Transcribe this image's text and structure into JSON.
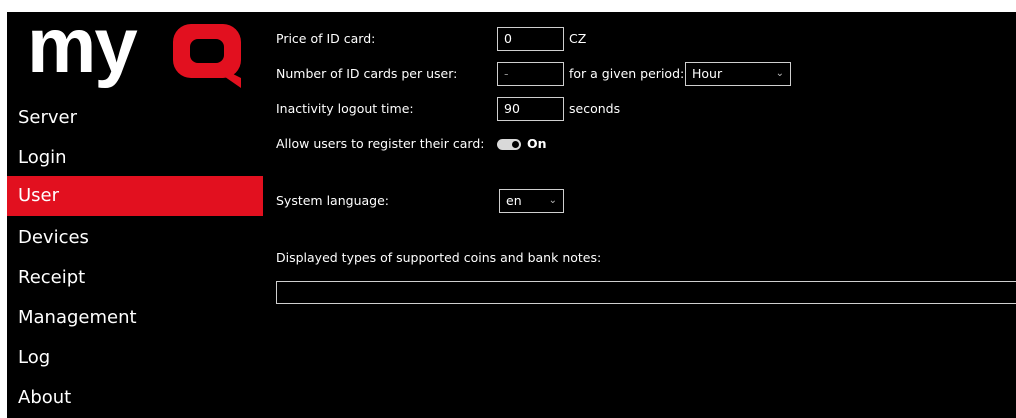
{
  "brand": {
    "logo_text": "myQ",
    "accent_color": "#e2101f"
  },
  "sidebar": {
    "items": [
      {
        "label": "Server",
        "active": false
      },
      {
        "label": "Login",
        "active": false
      },
      {
        "label": "User",
        "active": true
      },
      {
        "label": "Devices",
        "active": false
      },
      {
        "label": "Receipt",
        "active": false
      },
      {
        "label": "Management",
        "active": false
      },
      {
        "label": "Log",
        "active": false
      },
      {
        "label": "About",
        "active": false
      }
    ]
  },
  "settings": {
    "price_label": "Price of ID card:",
    "price_value": "0",
    "price_unit": "CZ",
    "cards_label": "Number of ID cards per user:",
    "cards_value": "-",
    "period_label": "for a given period:",
    "period_value": "Hour",
    "inactivity_label": "Inactivity logout time:",
    "inactivity_value": "90",
    "inactivity_unit": "seconds",
    "register_label": "Allow users to register their card:",
    "register_state": "On",
    "language_label": "System language:",
    "language_value": "en",
    "coins_label": "Displayed types of supported coins and bank notes:",
    "coins_value": ""
  }
}
